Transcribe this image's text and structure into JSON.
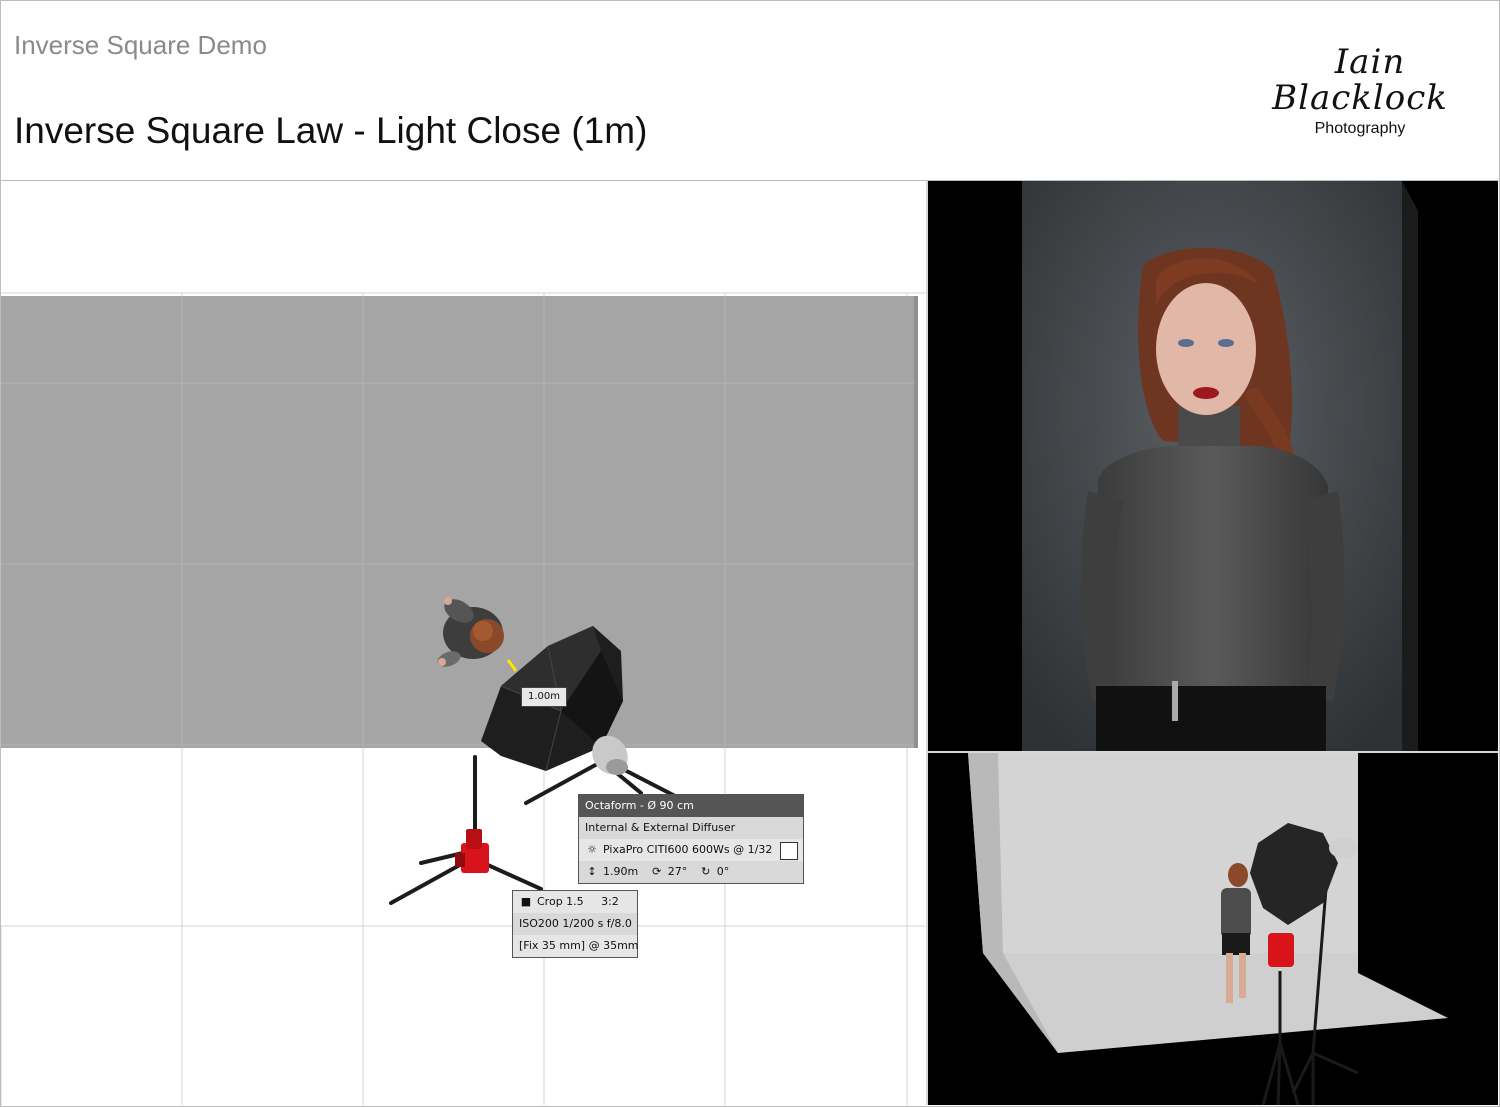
{
  "header": {
    "subtitle": "Inverse Square Demo",
    "title": "Inverse Square Law - Light Close (1m)"
  },
  "logo": {
    "line1": "Iain",
    "line2": "Blacklock",
    "line3": "Photography"
  },
  "plan": {
    "distance_label": "1.00m",
    "light_box": {
      "header": "Octaform - Ø 90 cm",
      "diffuser": "Internal & External Diffuser",
      "flash": "PixaPro CITI600 600Ws @ 1/32",
      "height": "1.90m",
      "tilt": "27°",
      "rotation": "0°",
      "swatch_color": "#ffffff"
    },
    "camera_box": {
      "crop": "Crop 1.5",
      "ratio": "3:2",
      "exposure": "ISO200  1/200 s f/8.0",
      "lens": "[Fix 35 mm] @ 35mm"
    }
  },
  "colors": {
    "backdrop": "#a5a5a5",
    "stand_red": "#d8141a",
    "info_header": "#555555"
  }
}
